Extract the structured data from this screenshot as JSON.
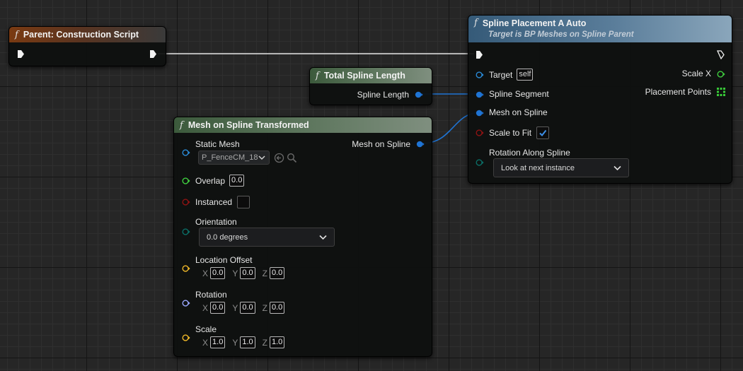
{
  "nodes": {
    "parent": {
      "title": "Parent: Construction Script",
      "func_icon": "f",
      "icon": "function-icon",
      "pins": [
        "exec-in-icon",
        "exec-out-icon"
      ]
    },
    "total_length": {
      "title": "Total Spline Length",
      "func_icon": "f",
      "output": "Spline Length"
    },
    "mesh_on_spline": {
      "title": "Mesh on Spline Transformed",
      "func_icon": "f",
      "output": "Mesh on Spline",
      "static_mesh": {
        "label": "Static Mesh",
        "value": "P_FenceCM_18"
      },
      "overlap": {
        "label": "Overlap",
        "value": "0.0"
      },
      "instanced": {
        "label": "Instanced",
        "checked": false
      },
      "orientation": {
        "label": "Orientation",
        "value": "0.0 degrees"
      },
      "location_offset": {
        "label": "Location Offset",
        "x": "0.0",
        "y": "0.0",
        "z": "0.0"
      },
      "rotation": {
        "label": "Rotation",
        "x": "0.0",
        "y": "0.0",
        "z": "0.0"
      },
      "scale": {
        "label": "Scale",
        "x": "1.0",
        "y": "1.0",
        "z": "1.0"
      },
      "axis_labels": {
        "x": "X",
        "y": "Y",
        "z": "Z"
      }
    },
    "spline_placement": {
      "title": "Spline Placement A Auto",
      "subtitle": "Target is BP Meshes on Spline Parent",
      "func_icon": "f",
      "target": {
        "label": "Target",
        "value": "self"
      },
      "spline_segment": "Spline Segment",
      "mesh_on_spline": "Mesh on Spline",
      "scale_to_fit": {
        "label": "Scale to Fit",
        "checked": true
      },
      "rotation_along_spline": {
        "label": "Rotation Along Spline",
        "value": "Look at next instance"
      },
      "scale_x": "Scale X",
      "placement_points": "Placement Points"
    }
  },
  "colors": {
    "exec_wire": "#e6e6e6",
    "object_pin": "#1f74d4",
    "bool_pin": "#8f1313",
    "float_pin": "#3fce3f",
    "enum_pin": "#0a6e66",
    "vector_pin": "#f1b928",
    "rotator_pin": "#9aa8ff",
    "array_pin": "#38c838"
  }
}
